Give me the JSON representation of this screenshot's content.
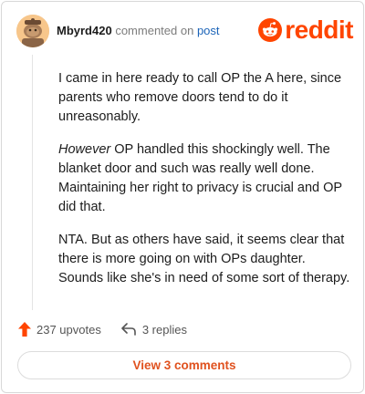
{
  "comment": {
    "username": "Mbyrd420",
    "action_text": "commented on",
    "post_link_text": "post",
    "paragraphs": [
      "I came in here ready to call OP the A here, since parents who remove doors tend to do it unreasonably.",
      {
        "emphasis": "However",
        "rest": " OP handled this shockingly well. The blanket door and such was really well done. Maintaining her right to privacy is crucial and OP did that."
      },
      "NTA. But as others have said, it seems clear that there is more going on with OPs daughter. Sounds like she's in need of some sort of therapy."
    ]
  },
  "brand": {
    "wordmark": "reddit",
    "color": "#ff4500"
  },
  "actions": {
    "upvotes": "237 upvotes",
    "replies": "3 replies",
    "view_comments": "View 3 comments"
  },
  "icons": {
    "avatar": "snoo-avatar-icon",
    "logo": "reddit-snoo-logo-icon",
    "upvote": "upvote-arrow-icon",
    "reply": "reply-arrow-icon"
  }
}
